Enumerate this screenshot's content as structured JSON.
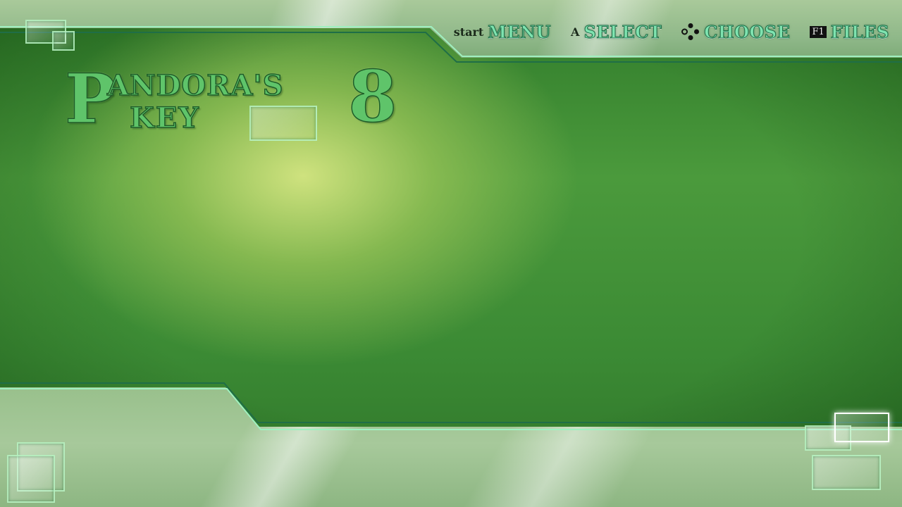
{
  "logo": {
    "letter_p": "P",
    "line1": "ANDORA'S",
    "line2": "KEY",
    "number": "8"
  },
  "controls": [
    {
      "key": "start",
      "label": "MENU"
    },
    {
      "key": "A",
      "label": "SELECT"
    },
    {
      "key": "dpad-icon",
      "label": "CHOOSE"
    },
    {
      "key": "F1",
      "label": "FILES"
    }
  ],
  "colors": {
    "accent": "#7fe3b0",
    "background": "#3f8d37",
    "band": "#a9c99a"
  }
}
